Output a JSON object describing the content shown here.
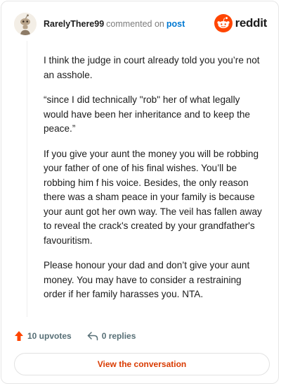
{
  "header": {
    "username": "RarelyThere99",
    "commented_on": "commented on",
    "post_link": "post",
    "brand": "reddit"
  },
  "comment": {
    "paragraphs": [
      "I think the judge in court already told you you’re not an asshole.",
      "“since I did technically \"rob\" her of what legally would have been her inheritance and to keep the peace.”",
      "If you give your aunt the money you will be robbing your father of one of his final wishes. You’ll be robbing him f his voice. Besides, the only reason there was a sham peace in your family is because your aunt got her own way. The veil has fallen away to reveal the crack's created by your grandfather's favouritism.",
      "Please honour your dad and don’t give your aunt money. You may have to consider a restraining order if her family harasses you. NTA."
    ]
  },
  "actions": {
    "upvotes": "10 upvotes",
    "replies": "0 replies"
  },
  "cta": {
    "label": "View the conversation"
  },
  "colors": {
    "brand": "#ff4500",
    "link": "#0079d3",
    "cta_text": "#d93a00"
  },
  "icons": {
    "avatar": "snoo-avatar-icon",
    "brand": "reddit-logo-icon",
    "upvote": "upvote-arrow-icon",
    "reply": "reply-arrow-icon"
  }
}
